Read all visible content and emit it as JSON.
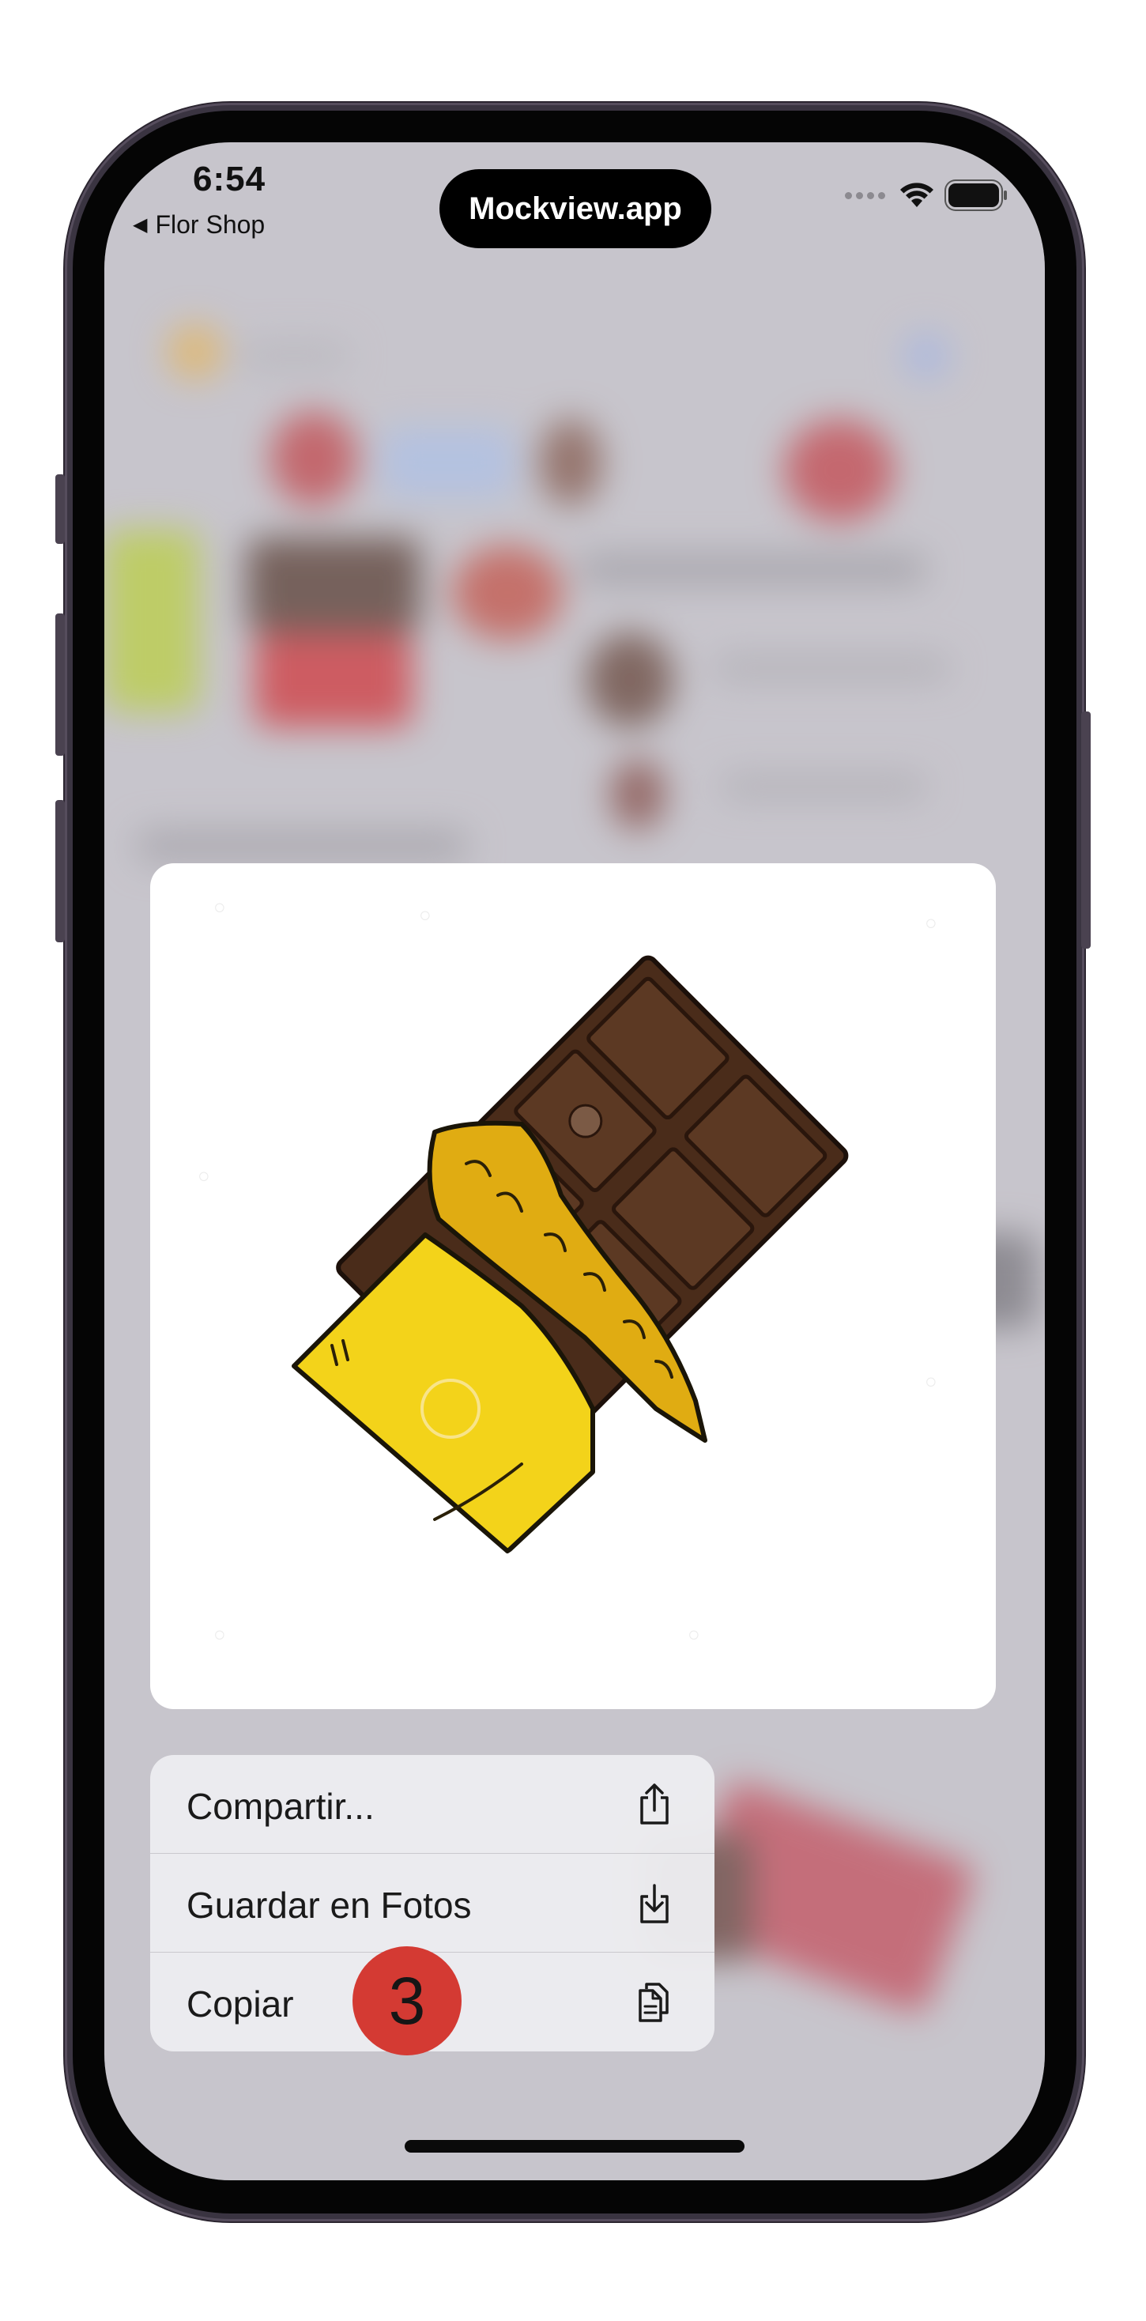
{
  "status_bar": {
    "time": "6:54",
    "back_app": "Flor Shop",
    "dynamic_island_text": "Mockview.app"
  },
  "preview": {
    "image_name": "chocolate-bar-illustration"
  },
  "context_menu": {
    "items": [
      {
        "label": "Compartir...",
        "icon": "share-icon"
      },
      {
        "label": "Guardar en Fotos",
        "icon": "save-to-photos-icon"
      },
      {
        "label": "Copiar",
        "icon": "copy-icon"
      }
    ]
  },
  "step_badge": "3",
  "colors": {
    "badge": "#d43a33",
    "chocolate": "#4a2c1a",
    "wrapper": "#f3d31a",
    "wrapper_fold": "#e0ac12"
  }
}
